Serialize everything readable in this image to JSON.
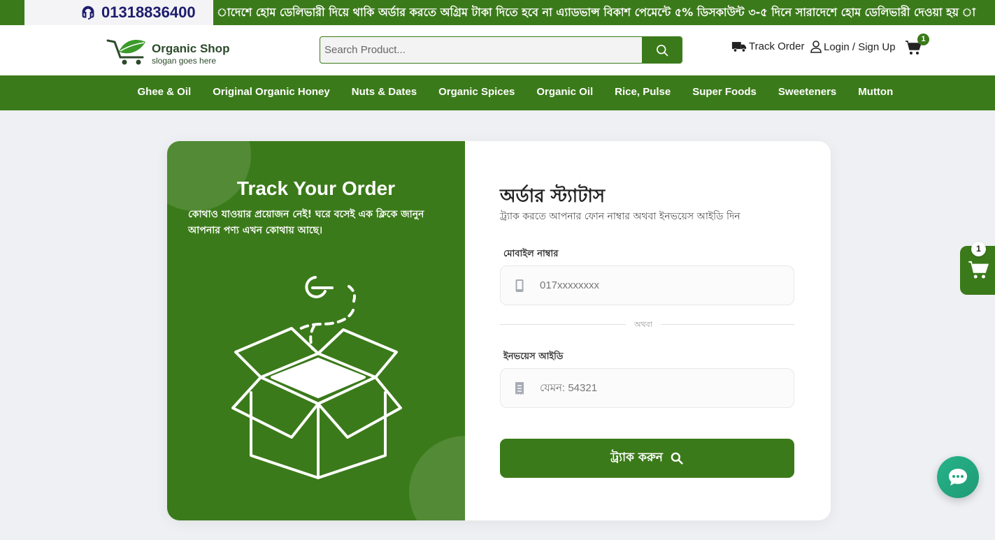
{
  "topbar": {
    "phone": "01318836400",
    "ticker": "াদেশে হোম ডেলিভারী দিয়ে থাকি অর্ডার করতে অগ্রিম টাকা দিতে হবে না এ্যাডভান্স বিকাশ পেমেন্টে ৫% ডিসকাউন্ট ৩-৫ দিনে সারাদেশে হোম ডেলিভারী দেওয়া হয় া"
  },
  "header": {
    "logo_title": "Organic Shop",
    "logo_sub": "slogan goes here",
    "search_placeholder": "Search Product...",
    "track_order": "Track Order",
    "login": "Login / Sign Up",
    "cart_count": "1"
  },
  "nav": {
    "items": [
      "Ghee & Oil",
      "Original Organic Honey",
      "Nuts & Dates",
      "Organic Spices",
      "Organic Oil",
      "Rice, Pulse",
      "Super Foods",
      "Sweeteners",
      "Mutton"
    ]
  },
  "left": {
    "title": "Track Your Order",
    "desc": "কোথাও যাওয়ার প্রয়োজন নেই! ঘরে বসেই এক ক্লিকে জানুন আপনার পণ্য এখন কোথায় আছে।"
  },
  "form": {
    "title": "অর্ডার স্ট্যাটাস",
    "subtitle": "ট্র্যাক করতে আপনার ফোন নাম্বার অথবা ইনভয়েস আইডি দিন",
    "mobile_label": "মোবাইল নাম্বার",
    "mobile_placeholder": "017xxxxxxxx",
    "or_text": "অথবা",
    "invoice_label": "ইনভয়েস আইডি",
    "invoice_placeholder": "যেমন: 54321",
    "button": "ট্র্যাক করুন"
  },
  "float_cart": {
    "count": "1"
  },
  "colors": {
    "brand": "#3b7a1a",
    "chat": "#27b38a",
    "page_bg": "#eef0f3"
  }
}
